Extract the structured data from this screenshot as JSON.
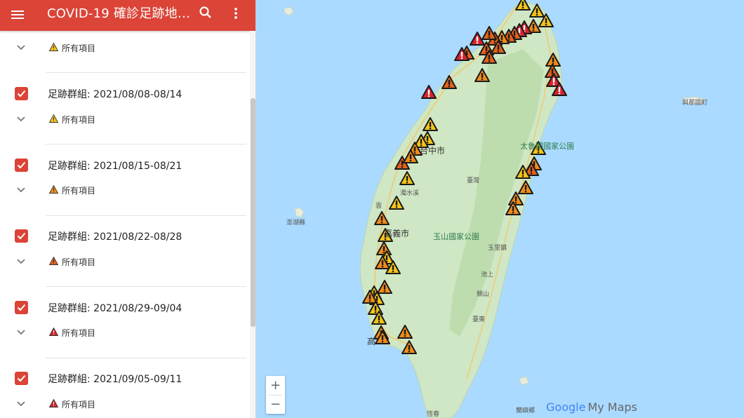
{
  "app": {
    "title": "COVID-19 確診足跡地…"
  },
  "colors": {
    "header": "#db4437",
    "marker_yellow": "#f5c518",
    "marker_orange": "#f08c1a",
    "marker_dark_orange": "#e2621b",
    "marker_red": "#d9232d"
  },
  "first_sub": {
    "label": "所有項目",
    "icon_color": "#f5c518"
  },
  "layers": [
    {
      "title": "足跡群組: 2021/08/08-08/14",
      "checked": true,
      "sub_label": "所有項目",
      "icon_color": "#f5c518"
    },
    {
      "title": "足跡群組: 2021/08/15-08/21",
      "checked": true,
      "sub_label": "所有項目",
      "icon_color": "#f08c1a"
    },
    {
      "title": "足跡群組: 2021/08/22-08/28",
      "checked": true,
      "sub_label": "所有項目",
      "icon_color": "#e2621b"
    },
    {
      "title": "足跡群組: 2021/08/29-09/04",
      "checked": true,
      "sub_label": "所有項目",
      "icon_color": "#d9232d"
    },
    {
      "title": "足跡群組: 2021/09/05-09/11",
      "checked": true,
      "sub_label": "所有項目",
      "icon_color": "#d9232d"
    }
  ],
  "map": {
    "labels": {
      "taichung": "台中市",
      "taiwan": "臺灣",
      "yushan": "玉山國家公園",
      "penghu": "澎湖縣",
      "chiayi": "嘉義市",
      "taroko": "太魯閣國家公園",
      "yonaguni": "與那國町",
      "yuli": "玉里鎮",
      "chishang": "池上",
      "guanshan": "關山",
      "taitung": "臺東",
      "hengchun": "恆春",
      "kaohsiung": "高",
      "yunlin": "雲",
      "zhuoshui": "濁水溪",
      "lanyu": "蘭嶼鄉"
    },
    "zoom_in": "+",
    "zoom_out": "−",
    "logo": {
      "google": "Google",
      "mymaps": "My Maps"
    }
  }
}
